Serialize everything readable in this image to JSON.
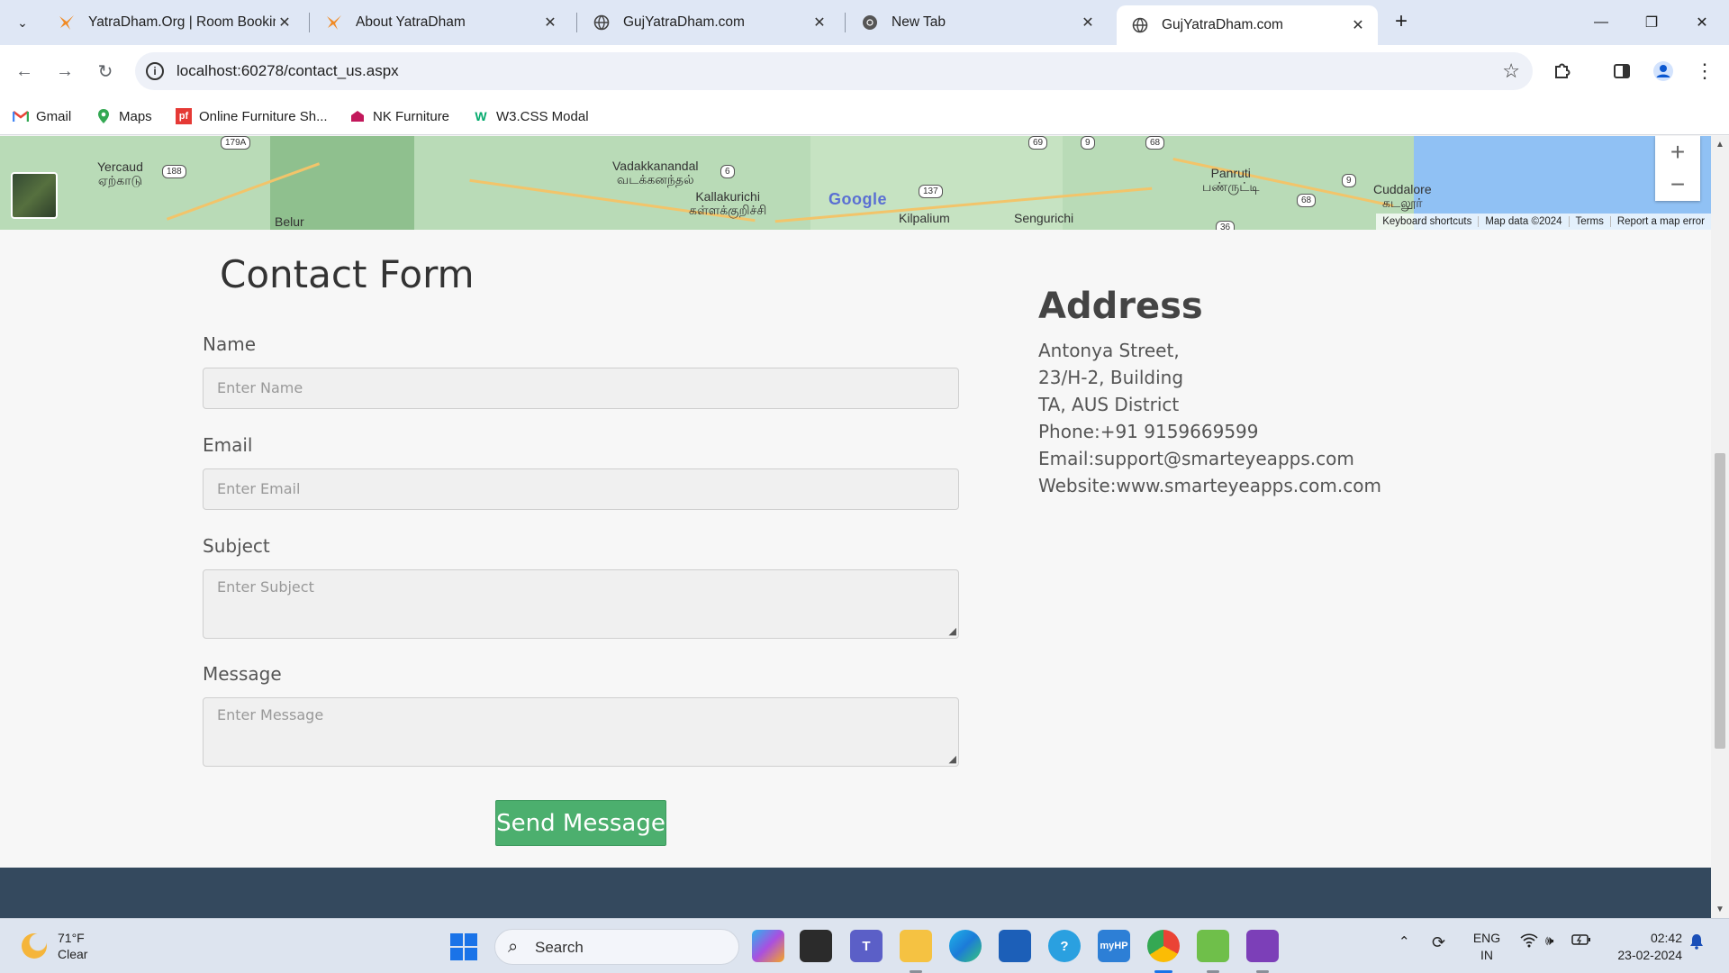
{
  "browser": {
    "tabs": [
      {
        "title": "YatraDham.Org | Room Booking",
        "icon": "yatradham-logo-icon",
        "active": false
      },
      {
        "title": "About YatraDham",
        "icon": "yatradham-logo-icon",
        "active": false
      },
      {
        "title": "GujYatraDham.com",
        "icon": "globe-icon",
        "active": false
      },
      {
        "title": "New Tab",
        "icon": "chrome-icon",
        "active": false
      },
      {
        "title": "GujYatraDham.com",
        "icon": "globe-icon",
        "active": true
      }
    ],
    "url": "localhost:60278/contact_us.aspx",
    "bookmarks": [
      {
        "label": "Gmail",
        "icon": "gmail-icon"
      },
      {
        "label": "Maps",
        "icon": "maps-icon"
      },
      {
        "label": "Online Furniture Sh...",
        "icon": "pf-icon"
      },
      {
        "label": "NK Furniture",
        "icon": "furniture-icon"
      },
      {
        "label": "W3.CSS Modal",
        "icon": "w3-icon"
      }
    ]
  },
  "map": {
    "places": [
      "Yercaud",
      "ஏற்காடு",
      "Belur",
      "Vadakkanandal",
      "வடக்கனந்தல்",
      "Kallakurichi",
      "கள்ளக்குறிச்சி",
      "Kilpalium",
      "Sengurichi",
      "Panruti",
      "பண்ருட்டி",
      "Cuddalore",
      "கடலூர்"
    ],
    "shields": [
      "188",
      "179A",
      "6",
      "137",
      "69",
      "9",
      "68",
      "9",
      "68",
      "36"
    ],
    "brand": "Google",
    "attribution": [
      "Keyboard shortcuts",
      "Map data ©2024",
      "Terms",
      "Report a map error"
    ]
  },
  "contact_form": {
    "title": "Contact Form",
    "name_label": "Name",
    "name_placeholder": "Enter Name",
    "email_label": "Email",
    "email_placeholder": "Enter Email",
    "subject_label": "Subject",
    "subject_placeholder": "Enter Subject",
    "message_label": "Message",
    "message_placeholder": "Enter Message",
    "submit_label": "Send Message"
  },
  "address": {
    "title": "Address",
    "lines": [
      "Antonya Street,",
      "23/H-2, Building",
      "TA, AUS District",
      "Phone:+91 9159669599",
      "Email:support@smarteyeapps.com",
      "Website:www.smarteyeapps.com.com"
    ]
  },
  "taskbar": {
    "weather_temp": "71°F",
    "weather_desc": "Clear",
    "search_label": "Search",
    "lang_top": "ENG",
    "lang_bottom": "IN",
    "time": "02:42",
    "date": "23-02-2024"
  },
  "colors": {
    "send_button": "#4caf6e",
    "footer": "#34495e",
    "tabstrip": "#dfe7f5"
  }
}
